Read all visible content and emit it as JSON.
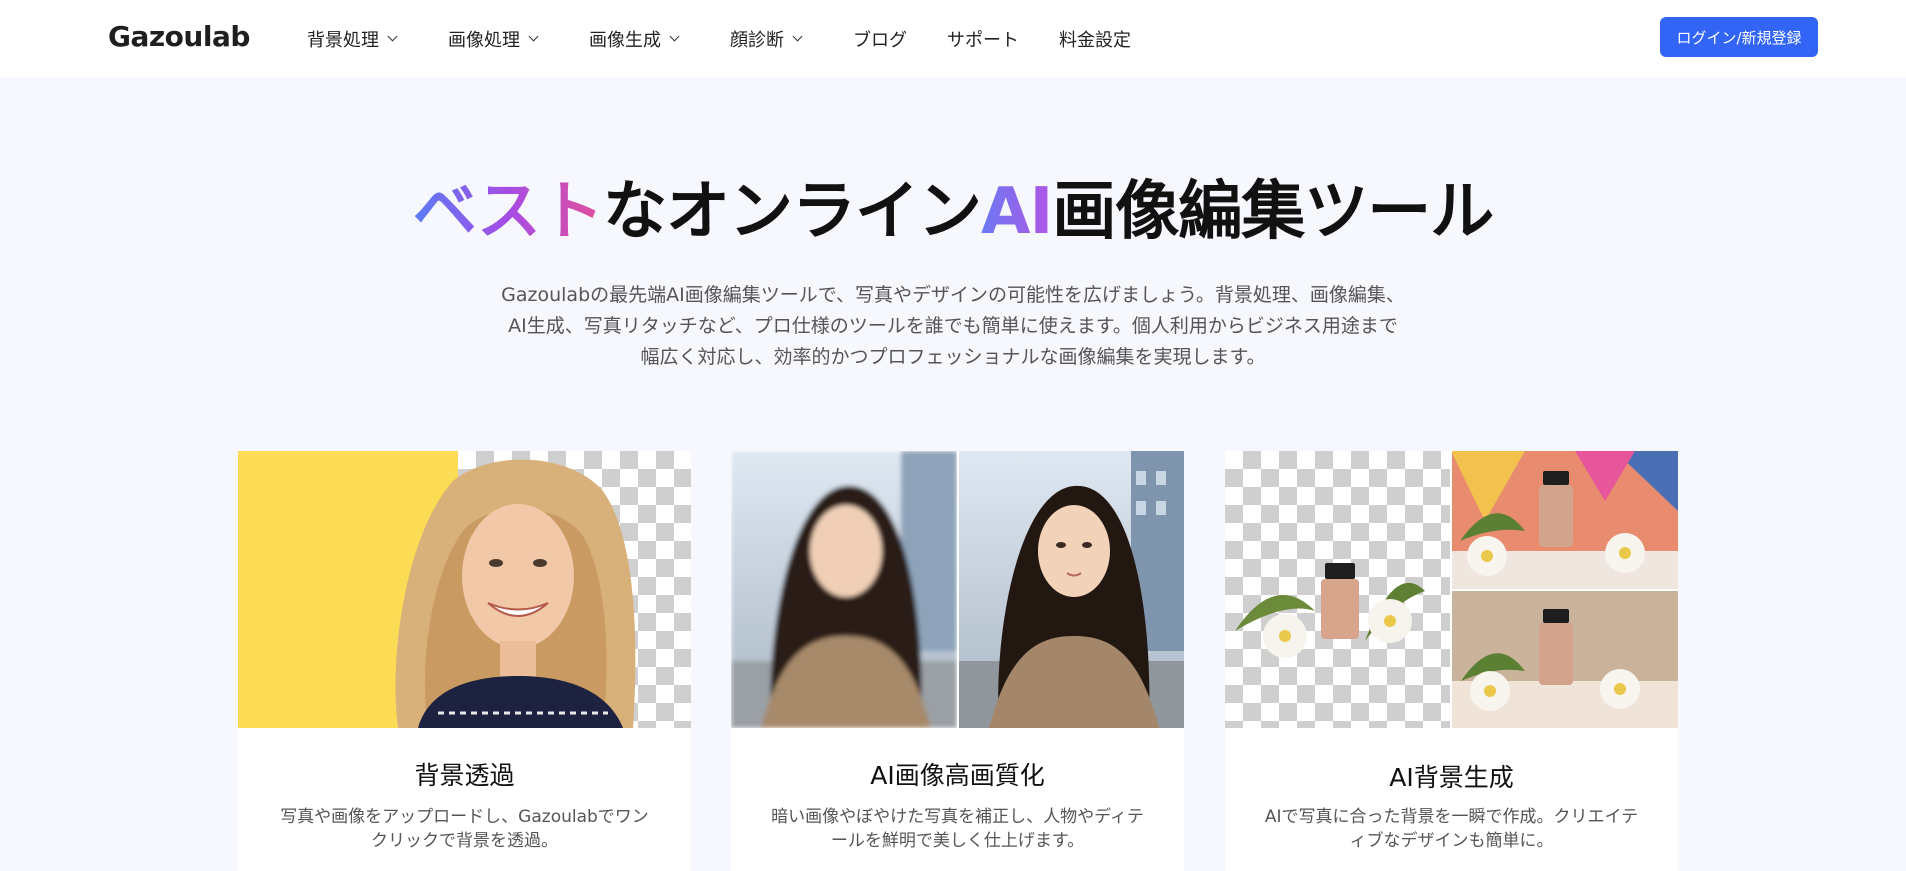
{
  "header": {
    "logo": "Gazoulab",
    "nav": [
      {
        "label": "背景処理",
        "has_dropdown": true
      },
      {
        "label": "画像処理",
        "has_dropdown": true
      },
      {
        "label": "画像生成",
        "has_dropdown": true
      },
      {
        "label": "顔診断",
        "has_dropdown": true
      },
      {
        "label": "ブログ",
        "has_dropdown": false
      },
      {
        "label": "サポート",
        "has_dropdown": false
      },
      {
        "label": "料金設定",
        "has_dropdown": false
      }
    ],
    "login_label": "ログイン/新規登録"
  },
  "hero": {
    "title_part1": "ベスト",
    "title_part2": "なオンライン",
    "title_part3": "AI",
    "title_part4": "画像編集ツール",
    "subtitle_line1": "Gazoulabの最先端AI画像編集ツールで、写真やデザインの可能性を広げましょう。背景処理、画像編集、",
    "subtitle_line2": "AI生成、写真リタッチなど、プロ仕様のツールを誰でも簡単に使えます。個人利用からビジネス用途まで",
    "subtitle_line3": "幅広く対応し、効率的かつプロフェッショナルな画像編集を実現します。"
  },
  "cards": [
    {
      "title": "背景透過",
      "desc_line1": "写真や画像をアップロードし、Gazoulabでワン",
      "desc_line2": "クリックで背景を透過。"
    },
    {
      "title": "AI画像高画質化",
      "desc_line1": "暗い画像やぼやけた写真を補正し、人物やディテ",
      "desc_line2": "ールを鮮明で美しく仕上げます。"
    },
    {
      "title": "AI背景生成",
      "desc_line1": "AIで写真に合った背景を一瞬で作成。クリエイテ",
      "desc_line2": "ィブなデザインも簡単に。"
    }
  ],
  "colors": {
    "accent": "#3264f5",
    "page_bg": "#f6f8fd",
    "gradient_start": "#5a7cf5",
    "gradient_end": "#e3509a"
  }
}
